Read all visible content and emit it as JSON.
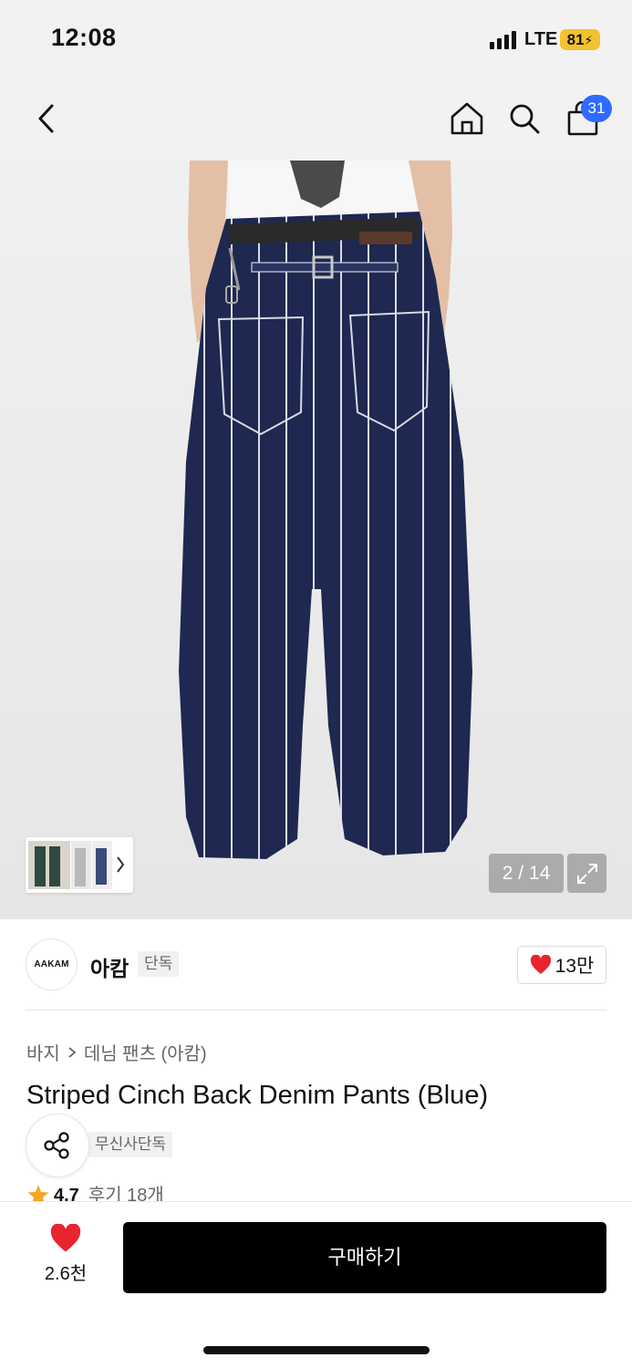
{
  "status": {
    "time": "12:08",
    "network": "LTE",
    "battery": "81"
  },
  "nav": {
    "back_icon": "chevron-left-icon",
    "home_icon": "home-icon",
    "search_icon": "search-icon",
    "cart_icon": "shopping-bag-icon",
    "cart_count": "31"
  },
  "gallery": {
    "counter": "2 / 14",
    "expand_icon": "expand-icon",
    "thumb_next_icon": "chevron-right-icon"
  },
  "brand": {
    "logo_text": "AAKAM",
    "name": "아캄",
    "tag": "단독",
    "likes": "13만"
  },
  "product": {
    "breadcrumb": [
      "바지",
      "데님 팬츠 (아캄)"
    ],
    "title": "Striped Cinch Back Denim Pants (Blue)",
    "exclusive_tag": "무신사단독",
    "rating": "4.7",
    "review_label": "후기 18개"
  },
  "bottom": {
    "wish_count": "2.6천",
    "buy_label": "구매하기"
  },
  "colors": {
    "accent": "#2f6bff",
    "heart": "#e8242f",
    "star": "#f5a623",
    "buy_button": "#000000"
  }
}
